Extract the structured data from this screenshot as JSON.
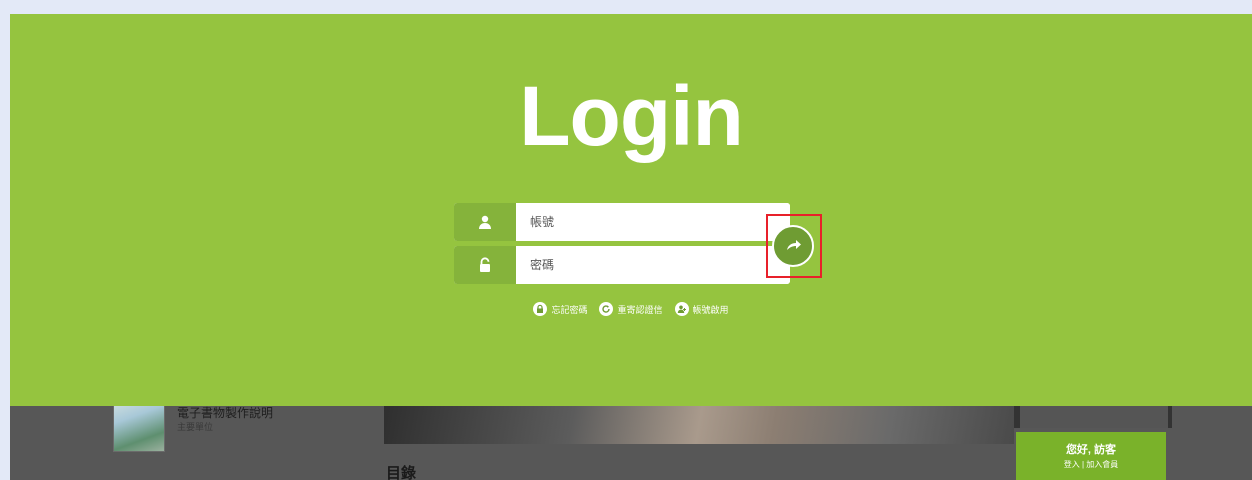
{
  "login": {
    "title": "Login",
    "account_placeholder": "帳號",
    "password_placeholder": "密碼"
  },
  "links": {
    "forgot": "忘記密碼",
    "resend": "重寄認證信",
    "activate": "帳號啟用"
  },
  "background": {
    "item_title": "電子書物製作說明",
    "item_sub": "主要單位",
    "section_heading": "目錄"
  },
  "guest": {
    "greeting": "您好, 訪客",
    "login": "登入",
    "separator": "|",
    "join": "加入會員"
  },
  "colors": {
    "overlay": "#95c43f",
    "icon_bg": "#85b33b",
    "submit": "#6f9c33",
    "highlight": "#e8202a"
  },
  "icons": [
    "user-icon",
    "lock-icon",
    "arrow-right-icon",
    "lock-small-icon",
    "refresh-icon",
    "user-plus-icon"
  ]
}
